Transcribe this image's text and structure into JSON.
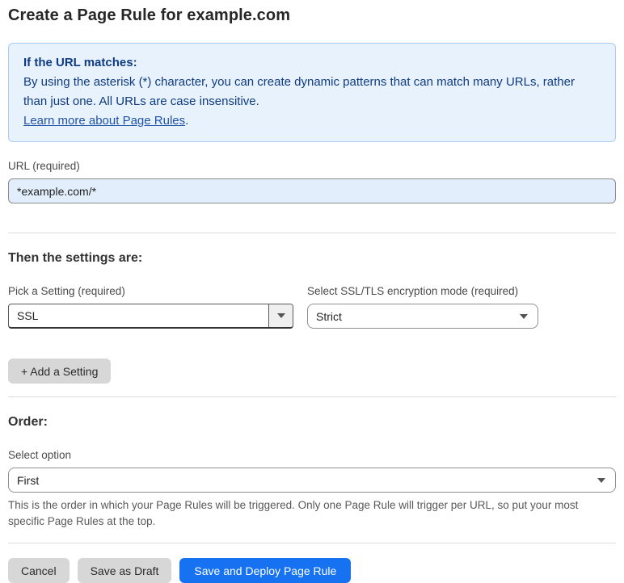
{
  "page": {
    "title": "Create a Page Rule for example.com"
  },
  "info_box": {
    "heading": "If the URL matches:",
    "body": "By using the asterisk (*) character, you can create dynamic patterns that can match many URLs, rather than just one. All URLs are case insensitive.",
    "link_label": "Learn more about Page Rules",
    "link_suffix": "."
  },
  "url_field": {
    "label": "URL (required)",
    "value": "*example.com/*"
  },
  "settings_section": {
    "heading": "Then the settings are:",
    "setting_picker": {
      "label": "Pick a Setting (required)",
      "value": "SSL"
    },
    "ssl_mode_picker": {
      "label": "Select SSL/TLS encryption mode (required)",
      "value": "Strict"
    },
    "add_setting_label": "+ Add a Setting"
  },
  "order_section": {
    "heading": "Order:",
    "select_label": "Select option",
    "value": "First",
    "help_text": "This is the order in which your Page Rules will be triggered. Only one Page Rule will trigger per URL, so put your most specific Page Rules at the top."
  },
  "footer": {
    "cancel_label": "Cancel",
    "save_draft_label": "Save as Draft",
    "save_deploy_label": "Save and Deploy Page Rule"
  },
  "colors": {
    "accent_blue": "#1672f1",
    "info_bg": "#e8f2fd",
    "info_border": "#a9ccf5",
    "info_text": "#0f3b82",
    "input_bg": "#e3eefd"
  }
}
